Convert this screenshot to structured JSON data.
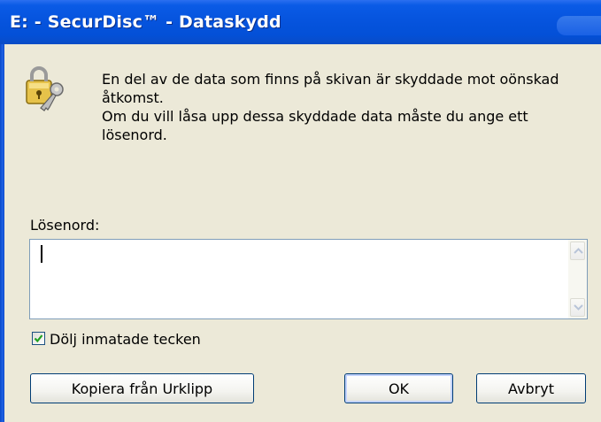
{
  "window": {
    "title": "E: - SecurDisc™ - Dataskydd"
  },
  "dialog": {
    "icon": "key-lock-icon",
    "message_line1": "En del av de data som finns på skivan är skyddade mot oönskad åtkomst.",
    "message_line2": "Om du vill låsa upp dessa skyddade data måste du ange ett lösenord.",
    "password_label": "Lösenord:",
    "password_value": "",
    "hide_chars_label": "Dölj inmatade tecken",
    "hide_chars_checked": true
  },
  "buttons": {
    "copy_label": "Kopiera från Urklipp",
    "ok_label": "OK",
    "cancel_label": "Avbryt"
  },
  "colors": {
    "titlebar": "#0654de",
    "dialog_bg": "#ece9d8",
    "button_border": "#003c74",
    "checkmark": "#21a121"
  }
}
